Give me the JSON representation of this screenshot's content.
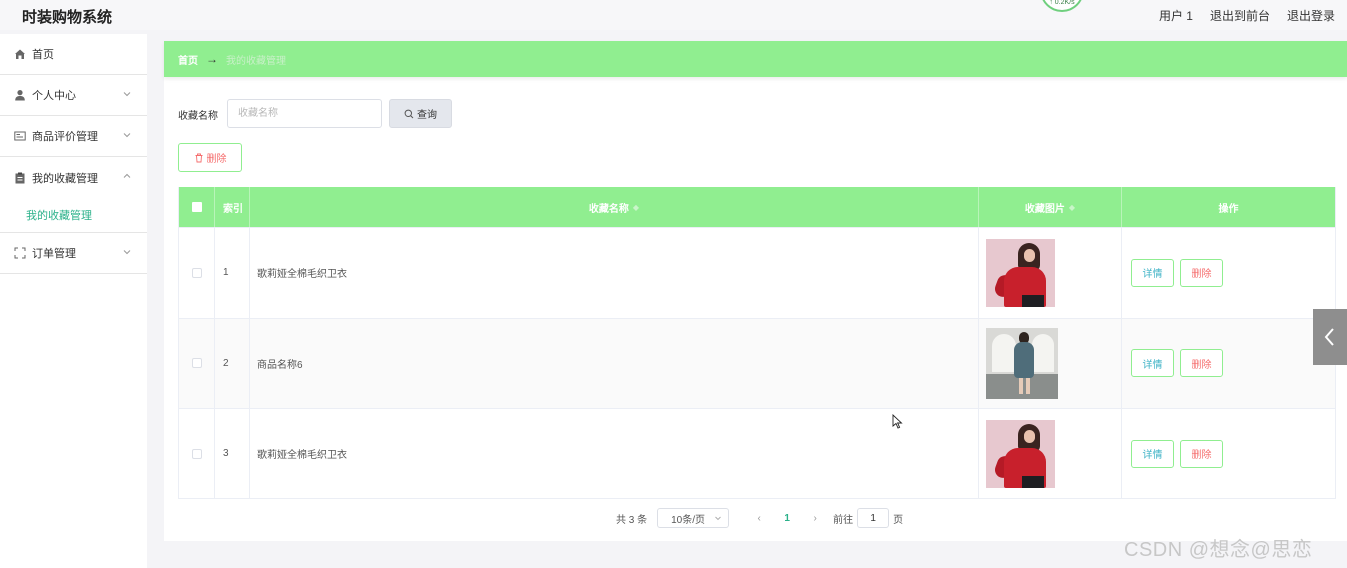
{
  "header": {
    "app_title": "时装购物系统",
    "speed": "↑ 0.2K/s",
    "user": "用户 1",
    "back_to_front": "退出到前台",
    "logout": "退出登录"
  },
  "sidebar": {
    "items": [
      {
        "label": "首页",
        "icon": "home-icon"
      },
      {
        "label": "个人中心",
        "icon": "user-icon"
      },
      {
        "label": "商品评价管理",
        "icon": "review-icon"
      },
      {
        "label": "我的收藏管理",
        "icon": "clipboard-icon"
      },
      {
        "label": "订单管理",
        "icon": "order-icon"
      }
    ],
    "submenu": {
      "label": "我的收藏管理"
    }
  },
  "breadcrumb": {
    "home": "首页",
    "arrow": "→",
    "current": "我的收藏管理"
  },
  "search": {
    "label": "收藏名称",
    "placeholder": "收藏名称",
    "value": "",
    "query_label": "查询"
  },
  "actions": {
    "delete_label": "删除"
  },
  "table": {
    "columns": [
      "索引",
      "收藏名称",
      "收藏图片",
      "操作"
    ],
    "rows": [
      {
        "index": "1",
        "name": "歌莉娅全棉毛织卫衣",
        "image": "red-jacket-photo"
      },
      {
        "index": "2",
        "name": "商品名称6",
        "image": "grey-dress-photo"
      },
      {
        "index": "3",
        "name": "歌莉娅全棉毛织卫衣",
        "image": "red-jacket-photo"
      }
    ],
    "detail_label": "详情",
    "delete_label": "删除"
  },
  "pagination": {
    "total": "共 3 条",
    "page_size": "10条/页",
    "prev": "‹",
    "current_page": "1",
    "next": "›",
    "goto_label": "前往",
    "goto_value": "1",
    "page_suffix": "页"
  },
  "watermark": "CSDN @想念@思恋",
  "colors": {
    "accent_green": "#90ee90",
    "link_teal": "#2bb18a",
    "danger": "#f56c6c"
  }
}
